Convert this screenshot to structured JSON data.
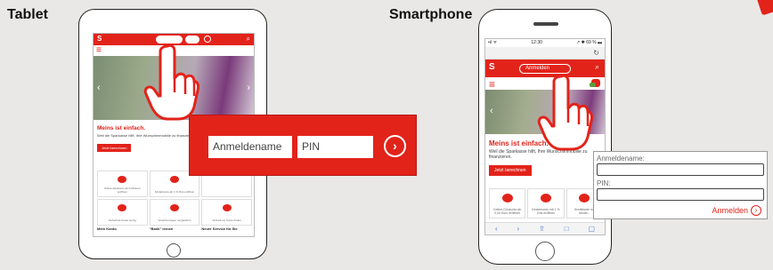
{
  "labels": {
    "tablet": "Tablet",
    "smartphone": "Smartphone"
  },
  "tablet": {
    "logo": "S",
    "headline": "Meins ist einfach.",
    "text": "Weil die Sparkasse hilft, Ihre Wunschimmobilie zu finanzieren.",
    "button": "Jetzt berechnen",
    "tiles": [
      "Online-Girokonto ab 0,00 Euro eröffnen",
      "Kinderkonto ab 1 % Zins eröffnen",
      "",
      "Sicherheit kostet wenig",
      "Versicherungen vergleichen",
      "Schnell ein Konto finden"
    ],
    "bottom": [
      "Mein Konto",
      "\"Bank\" lernen",
      "Neuer Service für Sie"
    ]
  },
  "login_red": {
    "username_placeholder": "Anmeldename",
    "pin_placeholder": "PIN",
    "submit_icon": "›"
  },
  "phone": {
    "status_time": "12:30",
    "status_left": "•ıl ᯤ",
    "status_right": "↗ ✱ 69 % ▬",
    "reload_icon": "↻",
    "logo": "S",
    "login_button": "Anmelden",
    "headline": "Meins ist einfach.",
    "text": "Weil die Sparkasse hilft, Ihre Wunschimmobilie zu finanzieren.",
    "button": "Jetzt berechnen",
    "tiles": [
      "Online-Girokonto ab 0,00 Euro eröffnen",
      "Kinderkonto mit 1 % Zins eröffnen",
      "Kreditkarte mit bester..."
    ],
    "toolbar": [
      "‹",
      "›",
      "⇪",
      "□",
      "▢"
    ]
  },
  "login_white": {
    "username_label": "Anmeldename:",
    "pin_label": "PIN:",
    "submit_label": "Anmelden",
    "submit_icon": "›"
  },
  "colors": {
    "brand_red": "#e2231a",
    "background": "#e9e8e6"
  }
}
